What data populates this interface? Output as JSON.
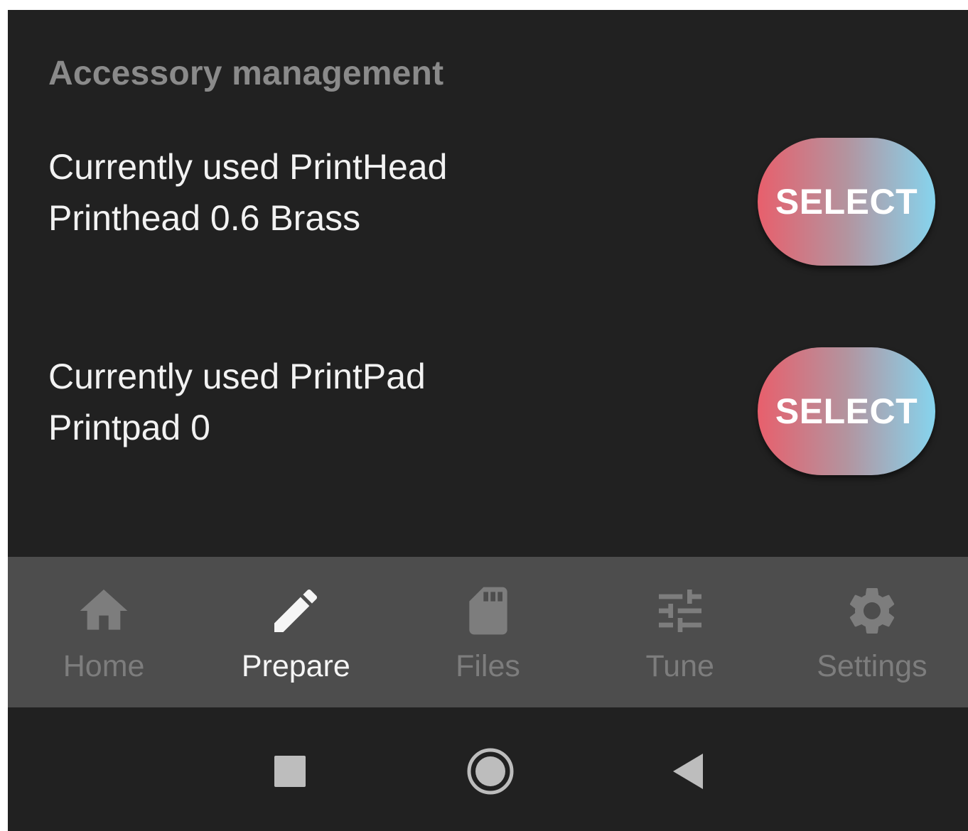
{
  "section": {
    "title": "Accessory management"
  },
  "accessories": [
    {
      "label": "Currently used PrintHead",
      "value": "Printhead 0.6 Brass",
      "button_label": "SELECT"
    },
    {
      "label": "Currently used PrintPad",
      "value": "Printpad 0",
      "button_label": "SELECT"
    }
  ],
  "bottom_nav": {
    "active": "Prepare",
    "items": [
      {
        "label": "Home",
        "icon": "home-icon"
      },
      {
        "label": "Prepare",
        "icon": "pencil-icon"
      },
      {
        "label": "Files",
        "icon": "sd-card-icon"
      },
      {
        "label": "Tune",
        "icon": "tune-icon"
      },
      {
        "label": "Settings",
        "icon": "gear-icon"
      }
    ]
  },
  "system_nav": {
    "buttons": [
      "recents-icon",
      "home-circle-icon",
      "back-icon"
    ]
  },
  "colors": {
    "background": "#212121",
    "nav_bar": "#4d4d4d",
    "button_gradient_start": "#e85f6c",
    "button_gradient_end": "#86d4ee",
    "inactive_nav": "#7d7d7d",
    "active_nav": "#f5f5f5"
  }
}
